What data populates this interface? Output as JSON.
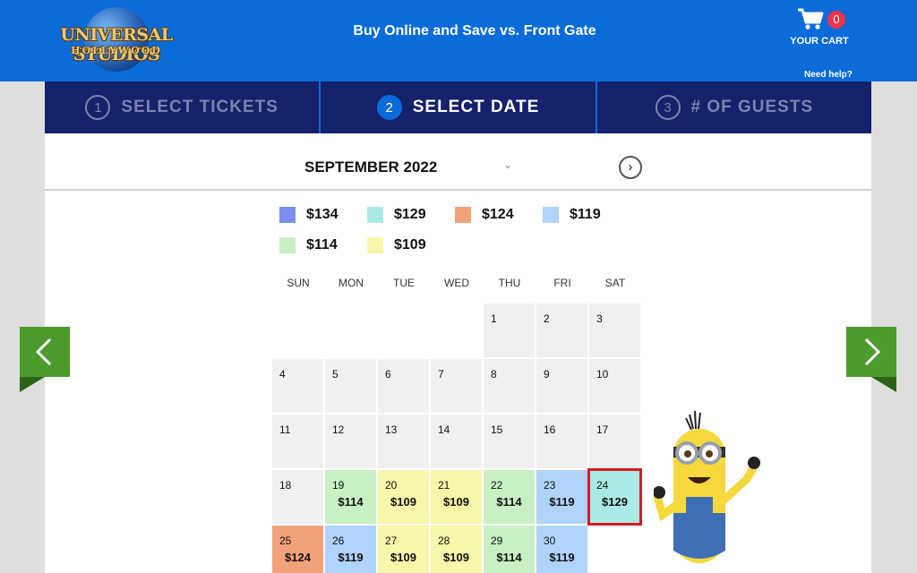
{
  "header": {
    "logo_line1": "UNIVERSAL STUDIOS",
    "logo_line2": "HOLLYWOOD",
    "tagline": "Buy Online and Save vs. Front Gate",
    "cart_count": "0",
    "cart_label": "YOUR CART",
    "cart_icon": "shopping-cart-icon",
    "need_help": "Need help?"
  },
  "steps": [
    {
      "number": "1",
      "label": "SELECT TICKETS",
      "active": false
    },
    {
      "number": "2",
      "label": "SELECT DATE",
      "active": true
    },
    {
      "number": "3",
      "label": "# OF GUESTS",
      "active": false
    }
  ],
  "calendar": {
    "month": "SEPTEMBER 2022",
    "caret_icon": "chevron-down-icon",
    "next_icon": "chevron-right-circle-icon",
    "legend": [
      {
        "price": "$134",
        "color": "#7b8ff0"
      },
      {
        "price": "$129",
        "color": "#a9eae6"
      },
      {
        "price": "$124",
        "color": "#f2a27a"
      },
      {
        "price": "$119",
        "color": "#b0d3fa"
      },
      {
        "price": "$114",
        "color": "#c9efc4"
      },
      {
        "price": "$109",
        "color": "#f8f6a8"
      }
    ],
    "weekdays": [
      "SUN",
      "MON",
      "TUE",
      "WED",
      "THU",
      "FRI",
      "SAT"
    ],
    "days": [
      {
        "day": "1",
        "price": ""
      },
      {
        "day": "2",
        "price": ""
      },
      {
        "day": "3",
        "price": ""
      },
      {
        "day": "4",
        "price": ""
      },
      {
        "day": "5",
        "price": ""
      },
      {
        "day": "6",
        "price": ""
      },
      {
        "day": "7",
        "price": ""
      },
      {
        "day": "8",
        "price": ""
      },
      {
        "day": "9",
        "price": ""
      },
      {
        "day": "10",
        "price": ""
      },
      {
        "day": "11",
        "price": ""
      },
      {
        "day": "12",
        "price": ""
      },
      {
        "day": "13",
        "price": ""
      },
      {
        "day": "14",
        "price": ""
      },
      {
        "day": "15",
        "price": ""
      },
      {
        "day": "16",
        "price": ""
      },
      {
        "day": "17",
        "price": ""
      },
      {
        "day": "18",
        "price": ""
      },
      {
        "day": "19",
        "price": "$114"
      },
      {
        "day": "20",
        "price": "$109"
      },
      {
        "day": "21",
        "price": "$109"
      },
      {
        "day": "22",
        "price": "$114"
      },
      {
        "day": "23",
        "price": "$119"
      },
      {
        "day": "24",
        "price": "$129",
        "selected": true
      },
      {
        "day": "25",
        "price": "$124"
      },
      {
        "day": "26",
        "price": "$119"
      },
      {
        "day": "27",
        "price": "$109"
      },
      {
        "day": "28",
        "price": "$109"
      },
      {
        "day": "29",
        "price": "$114"
      },
      {
        "day": "30",
        "price": "$119"
      }
    ],
    "first_weekday_index": 4,
    "selected_outline_color": "#d51c24"
  },
  "nav": {
    "prev_icon": "chevron-left-icon",
    "next_icon": "chevron-right-icon",
    "arrow_color": "#4d9a2d"
  },
  "mascot": "minion-illustration"
}
